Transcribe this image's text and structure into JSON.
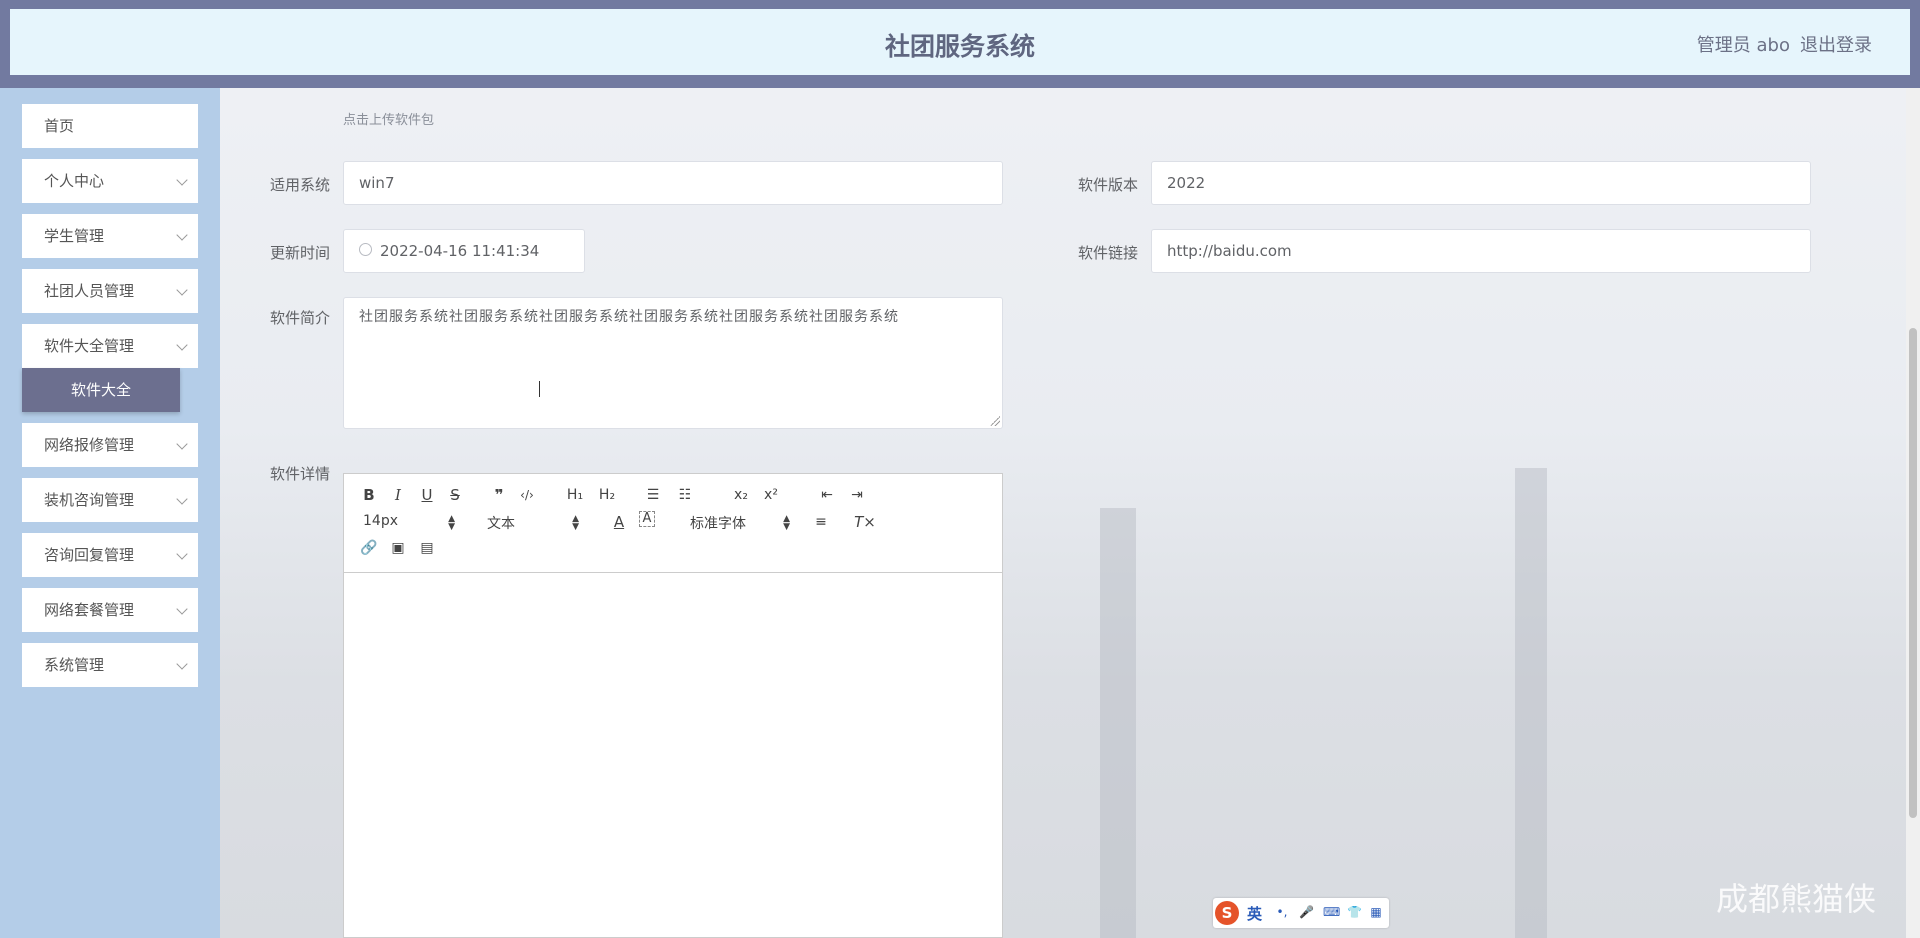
{
  "header": {
    "title": "社团服务系统",
    "user": "管理员 abo",
    "logout": "退出登录"
  },
  "sidebar": {
    "items": [
      {
        "label": "首页"
      },
      {
        "label": "个人中心"
      },
      {
        "label": "学生管理"
      },
      {
        "label": "社团人员管理"
      },
      {
        "label": "软件大全管理"
      },
      {
        "label": "网络报修管理"
      },
      {
        "label": "装机咨询管理"
      },
      {
        "label": "咨询回复管理"
      },
      {
        "label": "网络套餐管理"
      },
      {
        "label": "系统管理"
      }
    ],
    "active_sub": "软件大全"
  },
  "form": {
    "upload_hint": "点击上传软件包",
    "system_label": "适用系统",
    "system_value": "win7",
    "version_label": "软件版本",
    "version_value": "2022",
    "update_time_label": "更新时间",
    "update_time_value": "2022-04-16 11:41:34",
    "link_label": "软件链接",
    "link_value": "http://baidu.com",
    "intro_label": "软件简介",
    "intro_value": "社团服务系统社团服务系统社团服务系统社团服务系统社团服务系统社团服务系统",
    "detail_label": "软件详情"
  },
  "editor": {
    "font_size": "14px",
    "heading": "文本",
    "font_family": "标准字体"
  },
  "watermark": "成都熊猫侠",
  "ime": {
    "lang": "英"
  }
}
